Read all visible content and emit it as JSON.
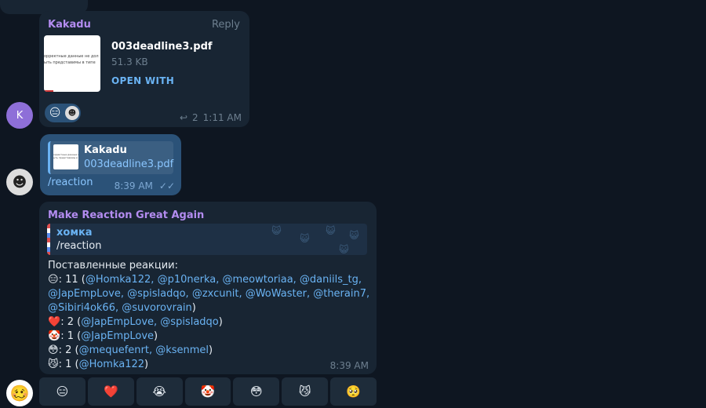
{
  "messages": [
    {
      "sender": "Kakadu",
      "avatar_letter": "K",
      "reply_label": "Reply",
      "file": {
        "name": "003deadline3.pdf",
        "size": "51.3 KB",
        "action": "OPEN WITH",
        "thumb_lines": [
          "орректные данные не дол",
          "ыть представимы в типе"
        ]
      },
      "reaction": {
        "emoji": "😑"
      },
      "reply_count": "2",
      "time": "1:11 AM"
    },
    {
      "quote_name": "Kakadu",
      "quote_file": "003deadline3.pdf",
      "text": "/reaction",
      "time": "8:39 AM"
    },
    {
      "sender": "Make Reaction Great Again",
      "quote_name": "хомка",
      "quote_text": "/reaction",
      "intro": "Поставленные реакции:",
      "reaction_lines": [
        {
          "emoji": "😑",
          "text": ": 11 (",
          "users": "@Homka122, @p10nerka, @meowtoriaa, @daniils_tg,",
          "end": ""
        },
        {
          "emoji": "",
          "text": "",
          "users": "@JapEmpLove, @spisladqo, @zxcunit, @WoWaster, @therain7,",
          "end": ""
        },
        {
          "emoji": "",
          "text": "",
          "users": "@Sibiri4ok66, @suvorovrain",
          "end": ")"
        },
        {
          "emoji": "❤️",
          "text": ": 2 (",
          "users": "@JapEmpLove, @spisladqo",
          "end": ")"
        },
        {
          "emoji": "🤡",
          "text": ": 1 (",
          "users": "@JapEmpLove",
          "end": ")"
        },
        {
          "emoji": "😳",
          "text": ": 2 (",
          "users": "@mequefenrt, @ksenmel",
          "end": ")"
        },
        {
          "emoji": "😼",
          "text": ": 1 (",
          "users": "@Homka122",
          "end": ")"
        }
      ],
      "time": "8:39 AM"
    }
  ],
  "keyboard": [
    "😑",
    "❤️",
    "😭",
    "🤡",
    "😳",
    "😼",
    "🥺"
  ],
  "bottom_avatar": "🥴",
  "colors": {
    "background": "#0e1621",
    "incoming": "#182533",
    "outgoing": "#2b5278",
    "link": "#6ab3f3",
    "sender": "#b38cf0"
  }
}
